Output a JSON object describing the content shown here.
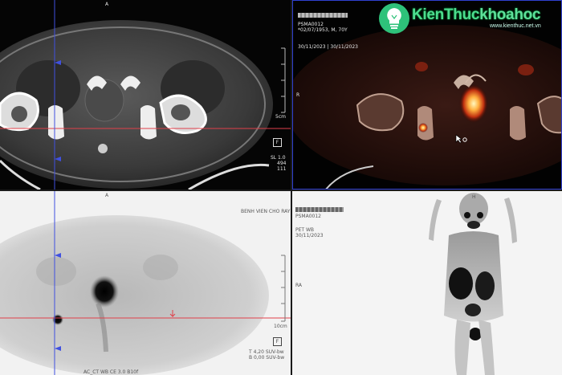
{
  "ct": {
    "orient_top": "A",
    "scale": "5cm",
    "slice_info": [
      "SL 1.0",
      "494",
      "111"
    ],
    "flag": "F"
  },
  "fusion": {
    "study_id": "PSMA0012",
    "patient_info": "*02/07/1953, M, 70Y",
    "dates": "30/11/2023 | 30/11/2023",
    "orient_left": "R"
  },
  "pet": {
    "orient_top": "A",
    "institution": "BENH VIEN CHO RAY",
    "scale": "10cm",
    "flag": "F",
    "suv_top": "T   4,20 SUV-bw",
    "suv_bottom": "B   0,00 SUV-bw",
    "recon": "AC_CT WB CE 3.0 B10f"
  },
  "mip": {
    "study_id": "PSMA0012",
    "series": "PET WB",
    "date": "30/11/2023",
    "orient_left": "RA",
    "orient_top": "H"
  },
  "watermark": {
    "brand": "KienThuc",
    "brand_suffix": "khoahoc",
    "url": "www.kienthuc.net.vn"
  },
  "colors": {
    "crosshair_h": "#e0404a",
    "crosshair_v": "#4050e0",
    "logo": "#2ec27a"
  }
}
